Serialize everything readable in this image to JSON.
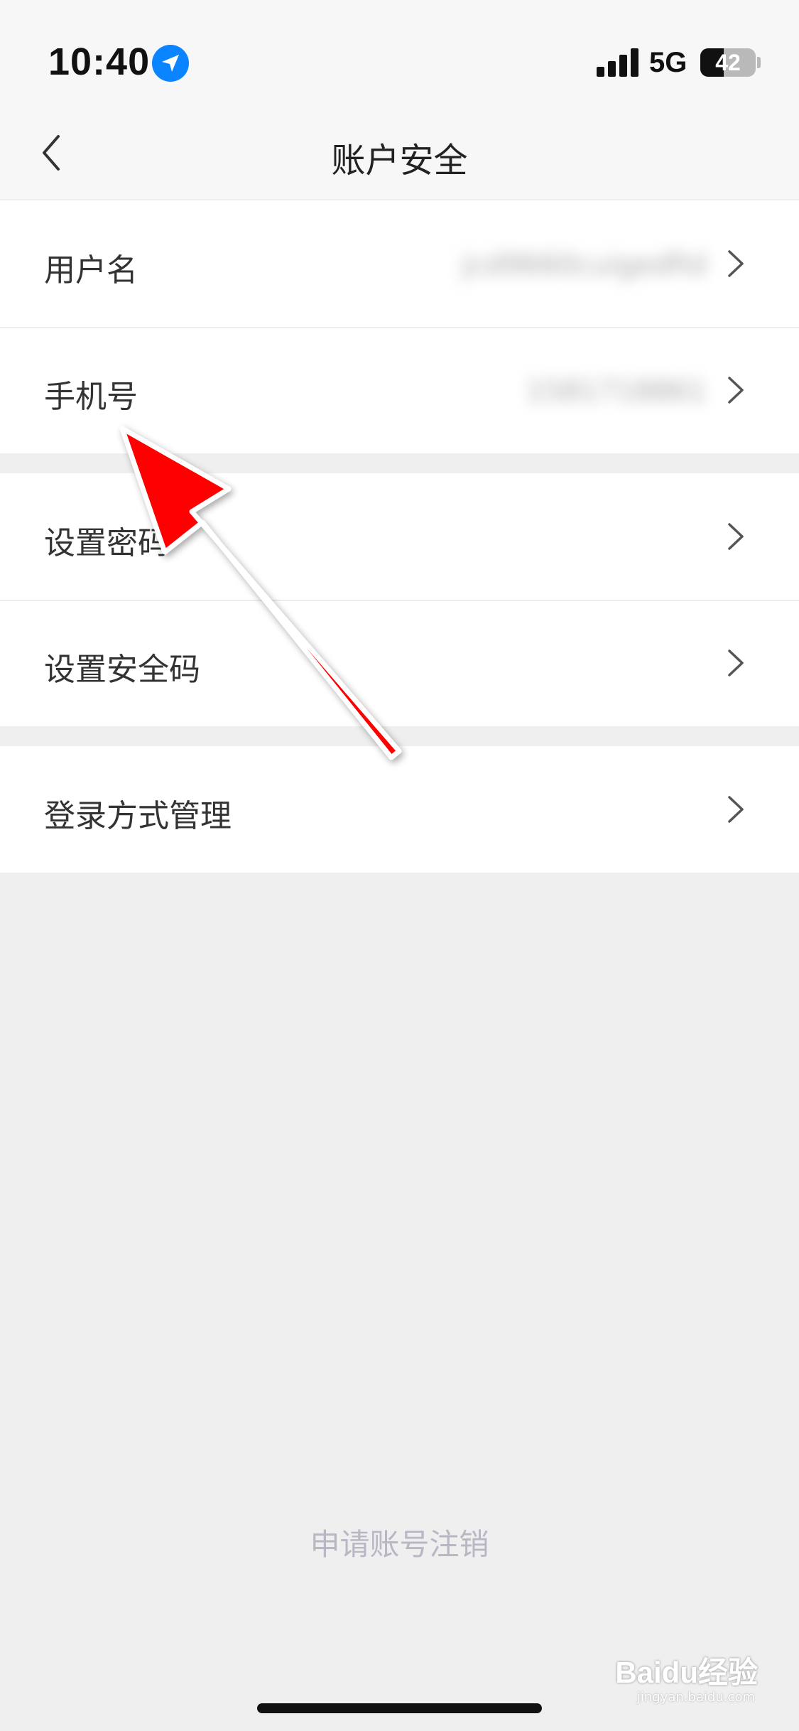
{
  "status_bar": {
    "time": "10:40",
    "network": "5G",
    "battery_level": "42",
    "battery_fraction": 0.42
  },
  "nav": {
    "title": "账户安全",
    "back_icon": "chevron-left-icon"
  },
  "groups": [
    {
      "rows": [
        {
          "label": "用户名",
          "value": "jcd9660cuigedfid"
        },
        {
          "label": "手机号",
          "value": "1581718861"
        }
      ]
    },
    {
      "rows": [
        {
          "label": "设置密码"
        },
        {
          "label": "设置安全码"
        }
      ]
    },
    {
      "rows": [
        {
          "label": "登录方式管理"
        }
      ]
    }
  ],
  "footer": {
    "deactivate_label": "申请账号注销"
  },
  "watermark": {
    "text": "Baidu经验",
    "sub": "jingyan.baidu.com"
  },
  "colors": {
    "accent_blue": "#0a84ff",
    "annotation_arrow": "#ff0000",
    "footer_link": "#b8b7c4"
  }
}
